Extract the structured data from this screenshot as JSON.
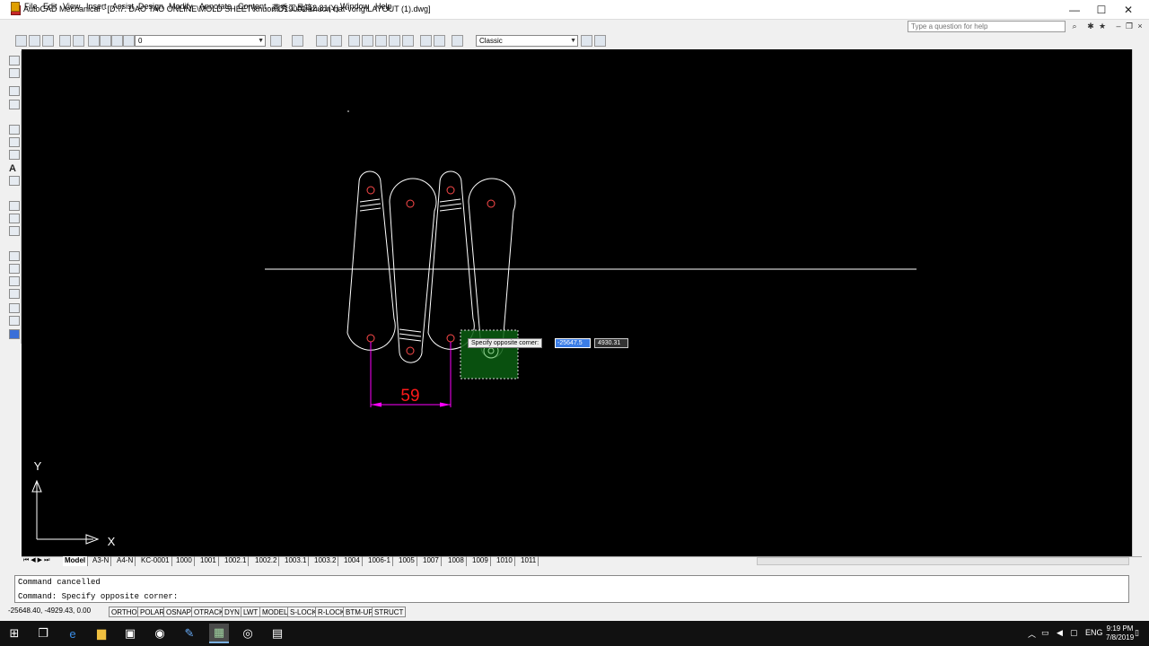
{
  "window": {
    "title": "AutoCAD Mechanical - [D:\\7. DAO TAO ONLINE\\MOLD SHEET\\khuon\\D19001-khuon-bat-vong\\LAYOUT (1).dwg]",
    "minimize": "—",
    "maximize": "☐",
    "close": "✕"
  },
  "menu": {
    "items": [
      "File",
      "Edit",
      "View",
      "Insert",
      "Assist",
      "Design",
      "Modify",
      "Annotate",
      "Content",
      "燕秀工具箱2.81(Y)",
      "Window",
      "Help"
    ]
  },
  "help_search": {
    "placeholder": "Type a question for help"
  },
  "toolbar": {
    "layer_value": "0",
    "style_value": "Classic"
  },
  "drawing": {
    "dimension_value": "59",
    "tooltip_prompt": "Specify opposite corner:",
    "input_x": "-25647.5",
    "input_y": "4930.31",
    "ucs_y": "Y",
    "ucs_x": "X",
    "colors": {
      "lines": "#ffffff",
      "dimension": "#ff00ff",
      "dimension_text": "#ff1a1a",
      "selection": "#0b5e12"
    }
  },
  "tabs": [
    "Model",
    "A3-N",
    "A4-N",
    "KC-0001",
    "1000",
    "1001",
    "1002.1",
    "1002.2",
    "1003.1",
    "1003.2",
    "1004",
    "1006-1",
    "1005",
    "1007",
    "1008",
    "1009",
    "1010",
    "1011"
  ],
  "command": {
    "line1": "Command cancelled",
    "line2": "Command: Specify opposite corner:"
  },
  "status": {
    "coords": "-25648.40, -4929.43, 0.00",
    "buttons": [
      "ORTHO",
      "POLAR",
      "OSNAP",
      "OTRACK",
      "DYN",
      "LWT",
      "MODEL",
      "S-LOCK",
      "R-LOCK",
      "BTM-UP",
      "STRUCT"
    ]
  },
  "taskbar": {
    "time": "9:19 PM",
    "date": "7/8/2019",
    "language": "ENG"
  }
}
